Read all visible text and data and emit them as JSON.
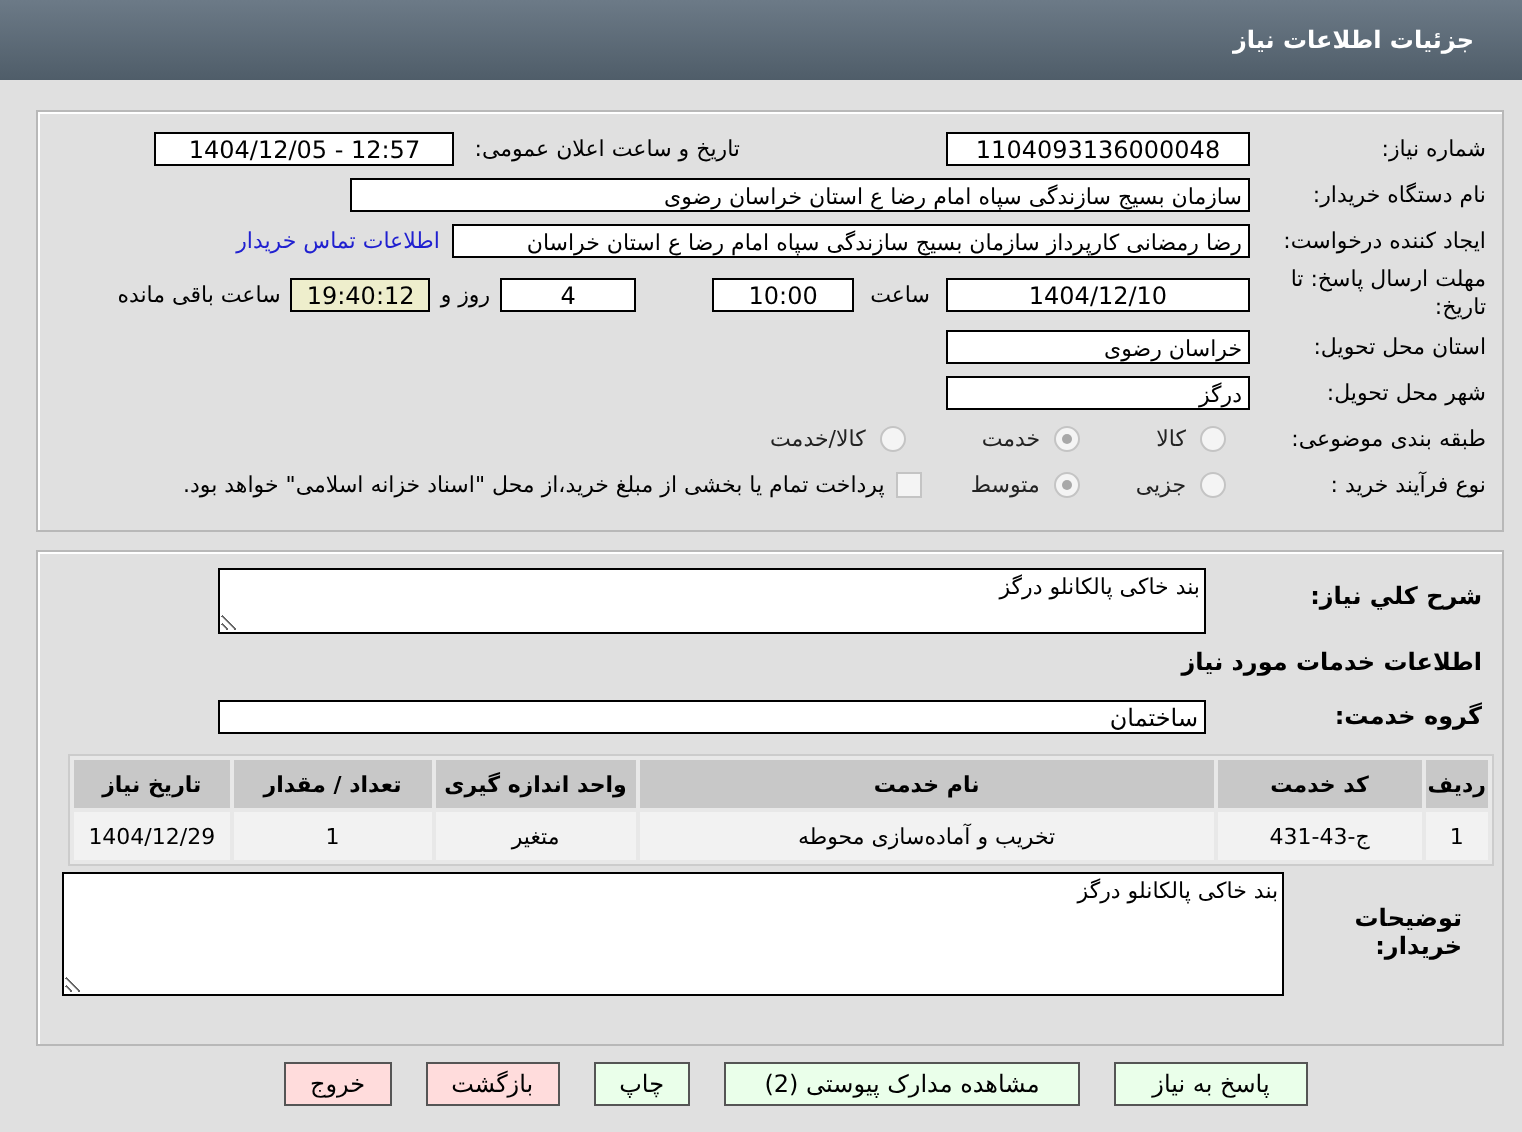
{
  "header": {
    "title": "جزئیات اطلاعات نیاز"
  },
  "details": {
    "need_number": {
      "label": "شماره نیاز:",
      "value": "1104093136000048"
    },
    "announce": {
      "label": "تاریخ و ساعت اعلان عمومی:",
      "value": "1404/12/05 - 12:57"
    },
    "buyer": {
      "label": "نام دستگاه خریدار:",
      "value": "سازمان بسیج سازندگی سپاه امام رضا  ع  استان خراسان رضوی"
    },
    "creator": {
      "label": "ایجاد کننده درخواست:",
      "value": "رضا رمضانی کارپرداز سازمان بسیج سازندگی سپاه امام رضا  ع  استان خراسان",
      "link": "اطلاعات تماس خریدار"
    },
    "deadline": {
      "label": "مهلت ارسال پاسخ: تا تاریخ:",
      "date": "1404/12/10",
      "time_label": "ساعت",
      "time": "10:00",
      "days": "4",
      "days_label": "روز و",
      "remaining": "19:40:12",
      "remaining_label": "ساعت باقی مانده"
    },
    "province": {
      "label": "استان محل تحویل:",
      "value": "خراسان رضوی"
    },
    "city": {
      "label": "شهر محل تحویل:",
      "value": "درگز"
    },
    "category": {
      "label": "طبقه بندی موضوعی:",
      "options": [
        {
          "label": "کالا",
          "selected": false
        },
        {
          "label": "خدمت",
          "selected": true
        },
        {
          "label": "کالا/خدمت",
          "selected": false
        }
      ]
    },
    "process": {
      "label": "نوع فرآیند خرید :",
      "options": [
        {
          "label": "جزیی",
          "selected": false
        },
        {
          "label": "متوسط",
          "selected": true
        }
      ],
      "treasury": {
        "label": "پرداخت تمام یا بخشی از مبلغ خرید،از محل \"اسناد خزانه اسلامی\" خواهد بود.",
        "checked": false
      }
    }
  },
  "service": {
    "description": {
      "label": "شرح کلي نياز:",
      "value": "بند خاکی پالکانلو درگز"
    },
    "section_title": "اطلاعات خدمات مورد نیاز",
    "group": {
      "label": "گروه خدمت:",
      "value": "ساختمان"
    },
    "table": {
      "columns": [
        "ردیف",
        "کد خدمت",
        "نام خدمت",
        "واحد اندازه گیری",
        "تعداد / مقدار",
        "تاریخ نیاز"
      ],
      "rows": [
        [
          "1",
          "ج-43-431",
          "تخریب و آماده‌سازی محوطه",
          "متغیر",
          "1",
          "1404/12/29"
        ]
      ]
    },
    "notes": {
      "label": "توضیحات خریدار:",
      "value": "بند خاکی پالکانلو درگز"
    }
  },
  "actions": {
    "buttons": [
      {
        "label": "پاسخ به نیاز",
        "color": "#eaffea"
      },
      {
        "label": "مشاهده مدارک پیوستی (2)",
        "color": "#eaffea"
      },
      {
        "label": "چاپ",
        "color": "#eaffea"
      },
      {
        "label": "بازگشت",
        "color": "#ffdcdc"
      },
      {
        "label": "خروج",
        "color": "#ffdcdc"
      }
    ]
  }
}
